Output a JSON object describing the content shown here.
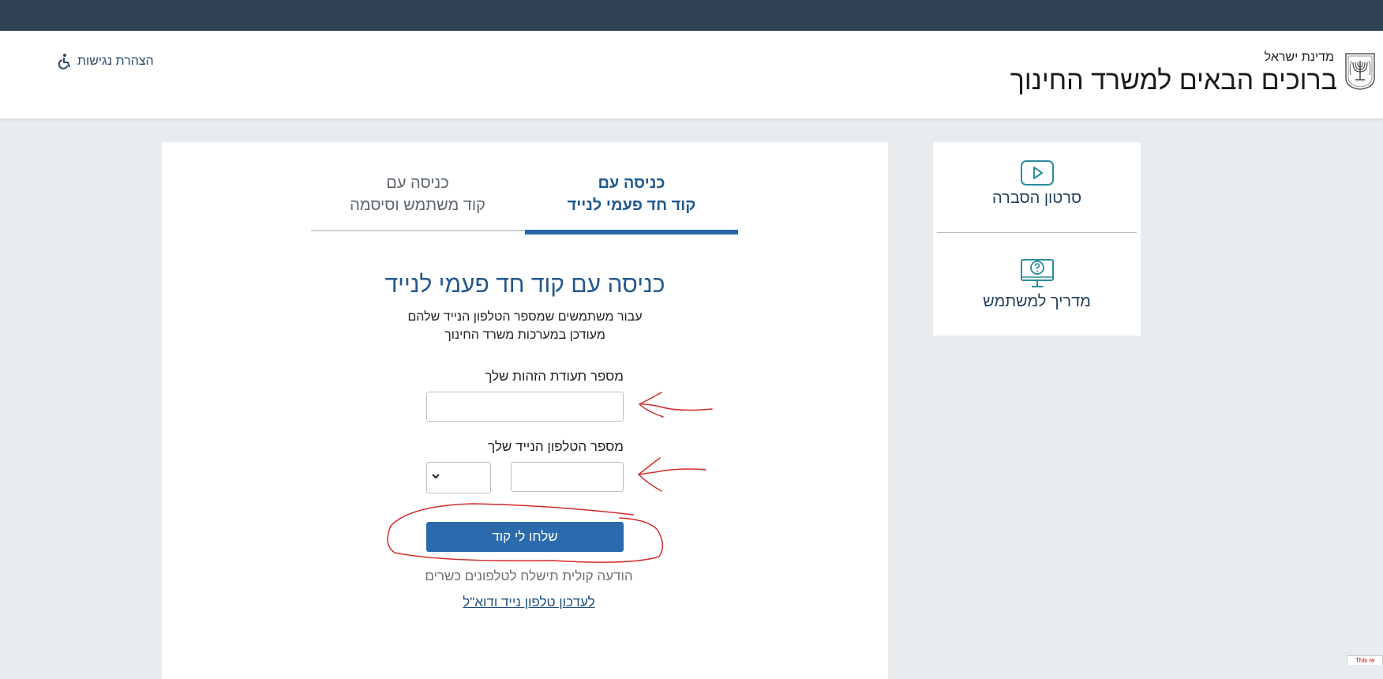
{
  "header": {
    "state_name": "מדינת ישראל",
    "site_title": "ברוכים הבאים למשרד החינוך",
    "accessibility_label": "הצהרת נגישות"
  },
  "tabs": [
    {
      "line1": "כניסה עם",
      "line2": "קוד חד פעמי לנייד",
      "active": true
    },
    {
      "line1": "כניסה עם",
      "line2": "קוד משתמש וסיסמה",
      "active": false
    }
  ],
  "form": {
    "title": "כניסה עם קוד חד פעמי לנייד",
    "subtitle_line1": "עבור משתמשים שמספר הטלפון הנייד שלהם",
    "subtitle_line2": "מעודכן במערכות משרד החינוך",
    "id_label": "מספר תעודת הזהות שלך",
    "id_value": "",
    "phone_label": "מספר הטלפון הנייד שלך",
    "phone_value": "",
    "prefix_value": "",
    "submit_label": "שלחו לי קוד",
    "voice_note": "הודעה קולית תישלח לטלפונים כשרים",
    "update_link": "לעדכון טלפון נייד ודוא\"ל"
  },
  "side_panel": {
    "video_label": "סרטון הסברה",
    "guide_label": "מדריך למשתמש"
  },
  "corner_badge": "This re",
  "colors": {
    "topbar": "#2f4254",
    "accent": "#2a6aad",
    "title_blue": "#24598e",
    "annotation_red": "#d42a2a",
    "icon_teal": "#2a8c9c"
  }
}
